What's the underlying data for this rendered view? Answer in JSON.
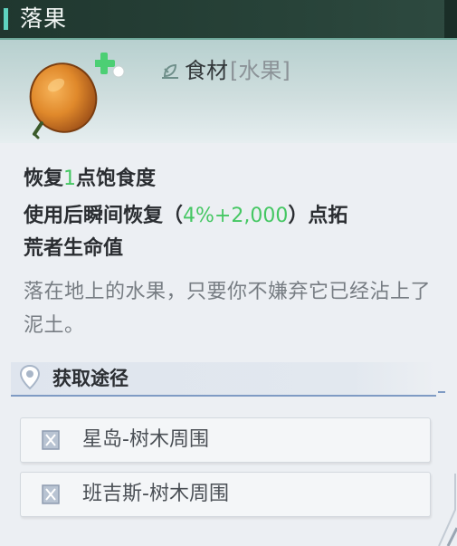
{
  "item": {
    "name": "落果",
    "category": "食材",
    "subcategory": "[水果]"
  },
  "effects": {
    "line1_a": "恢复",
    "line1_value": "1",
    "line1_b": "点饱食度",
    "line2_a": "使用后瞬间恢复（",
    "line2_value": "4%+2,000",
    "line2_b": "）点拓",
    "line3": "荒者生命值"
  },
  "description": "落在地上的水果，只要你不嫌弃它已经沾上了泥土。",
  "sources": {
    "title": "获取途径",
    "items": [
      {
        "label": "星岛-树木周围"
      },
      {
        "label": "班吉斯-树木周围"
      }
    ]
  },
  "colors": {
    "accent_green": "#45c763",
    "title_bar": "#274238",
    "title_accent": "#5fd3c0"
  }
}
